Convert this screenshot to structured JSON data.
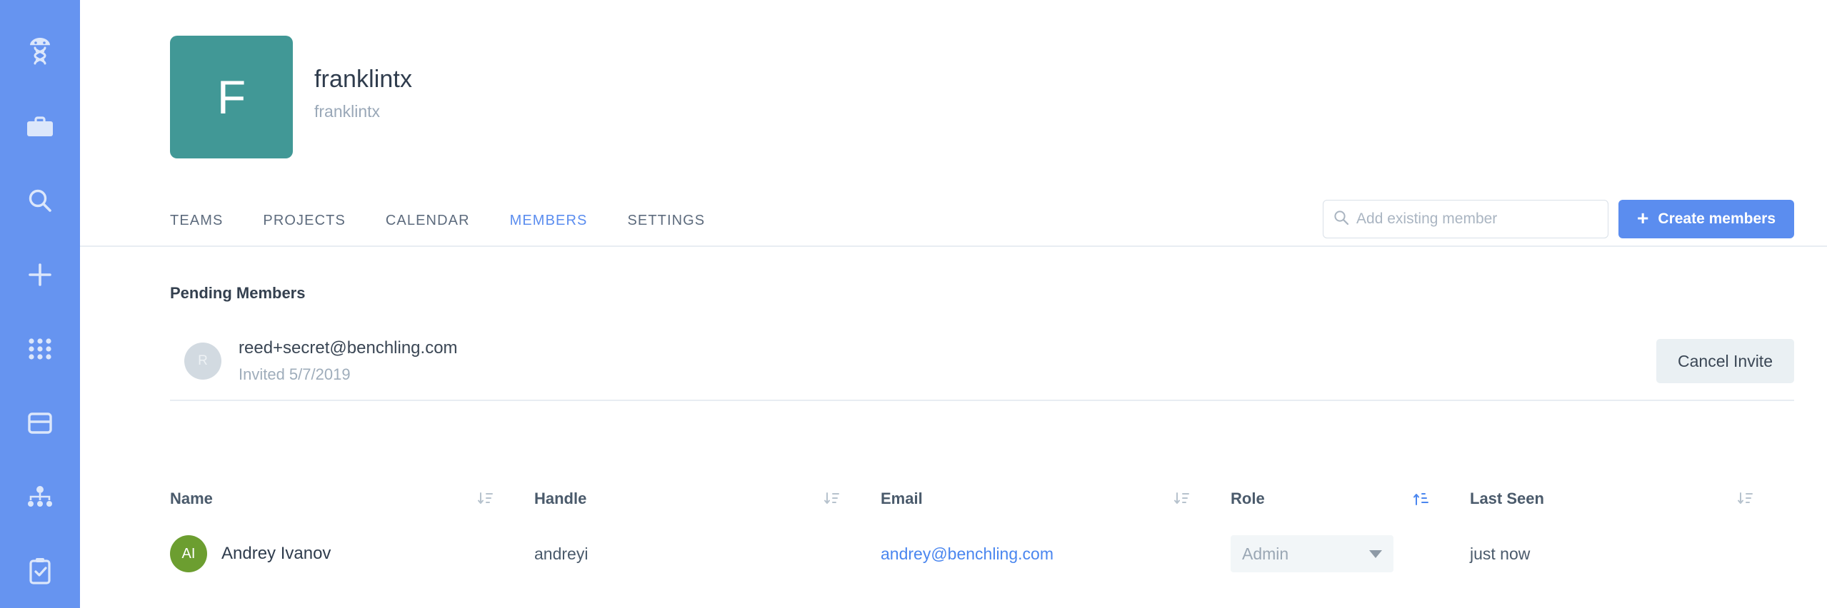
{
  "sidebar": {
    "items": [
      {
        "name": "benchling-logo-icon",
        "icon": "dna-helmet-icon"
      },
      {
        "name": "projects-icon",
        "icon": "briefcase-icon"
      },
      {
        "name": "search-icon",
        "icon": "search-icon"
      },
      {
        "name": "create-icon",
        "icon": "plus-icon"
      },
      {
        "name": "apps-icon",
        "icon": "grid-dots-icon"
      },
      {
        "name": "plates-icon",
        "icon": "plate-icon"
      },
      {
        "name": "workflows-icon",
        "icon": "hierarchy-icon"
      },
      {
        "name": "tasks-icon",
        "icon": "clipboard-check-icon"
      }
    ]
  },
  "org": {
    "avatar_initial": "F",
    "avatar_color": "#419896",
    "name": "franklintx",
    "handle": "franklintx"
  },
  "tabs": [
    {
      "label": "TEAMS",
      "active": false
    },
    {
      "label": "PROJECTS",
      "active": false
    },
    {
      "label": "CALENDAR",
      "active": false
    },
    {
      "label": "MEMBERS",
      "active": true
    },
    {
      "label": "SETTINGS",
      "active": false
    }
  ],
  "toolbar": {
    "search_placeholder": "Add existing member",
    "search_value": "",
    "create_label": "Create members",
    "create_plus": "+",
    "accent_color": "#5b8def"
  },
  "pending": {
    "title": "Pending Members",
    "members": [
      {
        "initial": "R",
        "avatar_color": "#d2dae1",
        "email": "reed+secret@benchling.com",
        "invited": "Invited 5/7/2019",
        "action_label": "Cancel Invite"
      }
    ]
  },
  "members_table": {
    "columns": [
      {
        "label": "Name",
        "sort": "desc",
        "active": false
      },
      {
        "label": "Handle",
        "sort": "desc",
        "active": false
      },
      {
        "label": "Email",
        "sort": "desc",
        "active": false
      },
      {
        "label": "Role",
        "sort": "asc",
        "active": true
      },
      {
        "label": "Last Seen",
        "sort": "desc",
        "active": false
      }
    ],
    "rows": [
      {
        "initials": "AI",
        "avatar_color": "#6c9e30",
        "name": "Andrey Ivanov",
        "handle": "andreyi",
        "email": "andrey@benchling.com",
        "role": "Admin",
        "last_seen": "just now"
      }
    ]
  }
}
